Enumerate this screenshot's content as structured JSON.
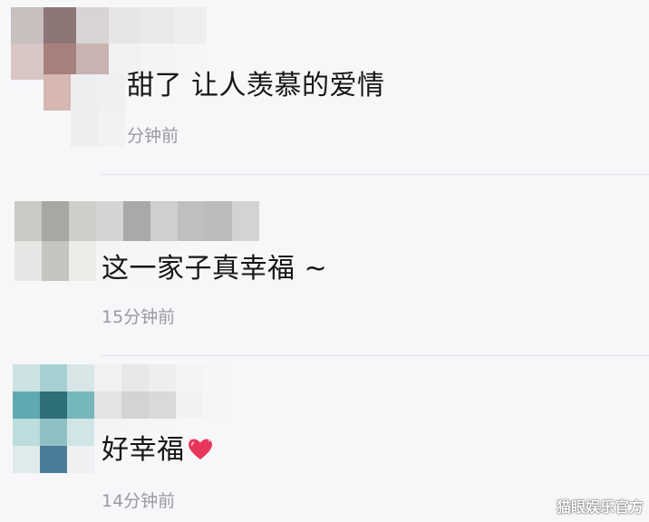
{
  "comments": [
    {
      "text": "甜了 让人羡慕的爱情",
      "time": "分钟前"
    },
    {
      "text": "这一家子真幸福 ~",
      "time": "15分钟前"
    },
    {
      "text": "好幸福",
      "emoji": "heart-emoji",
      "time": "14分钟前"
    }
  ],
  "watermark": "猫眼娱乐官方",
  "colors": {
    "background": "#f7f7fa",
    "text": "#161616",
    "timestamp": "#9a9a9f",
    "heart": "#e8355a"
  }
}
